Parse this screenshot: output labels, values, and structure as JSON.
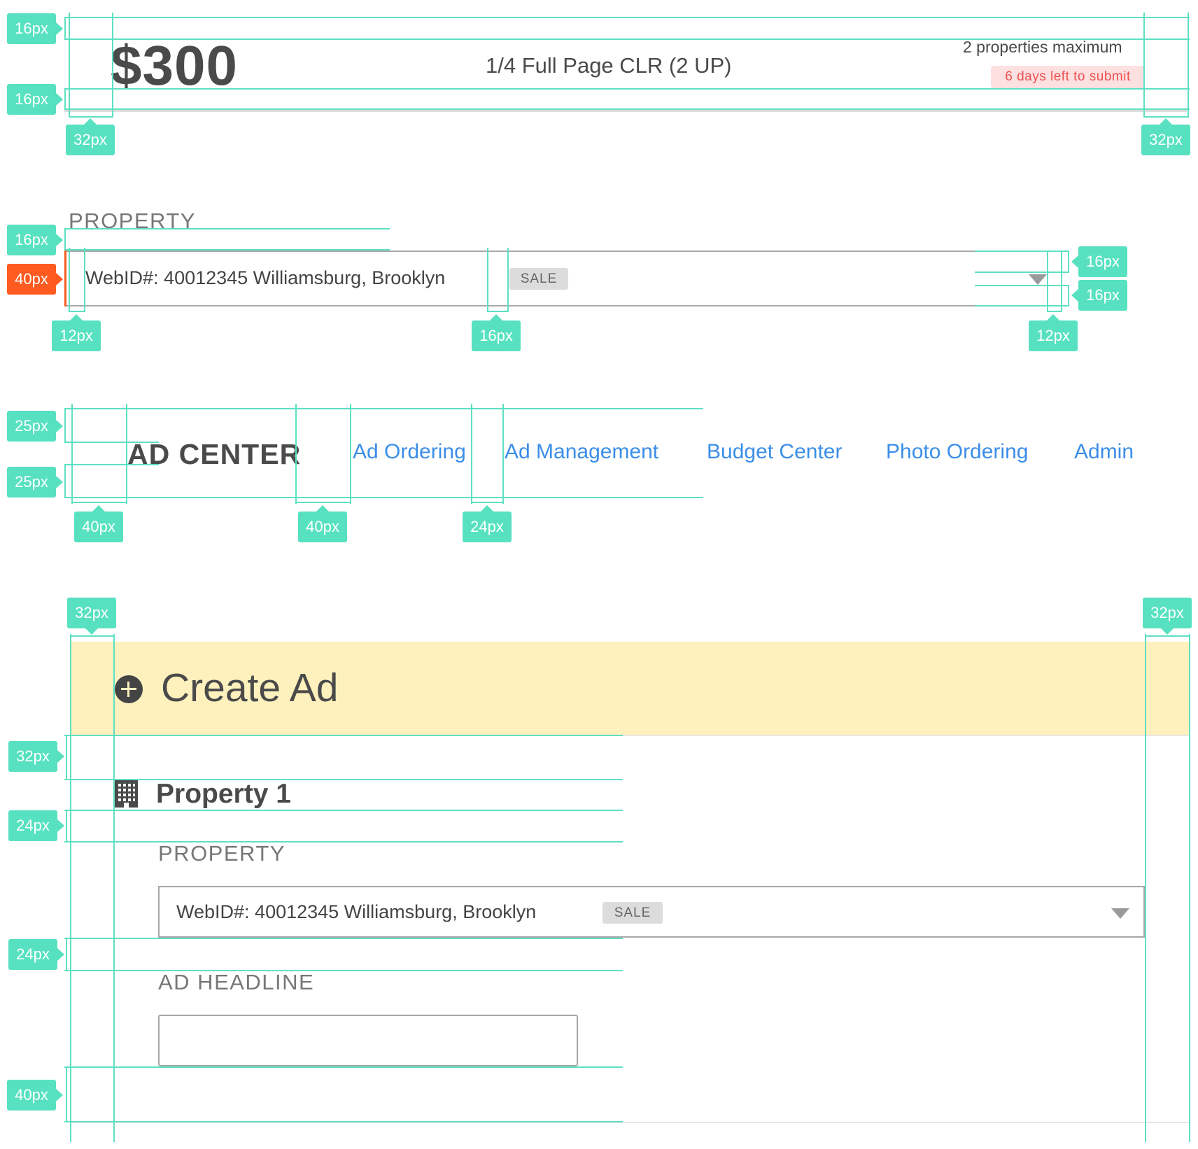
{
  "price_card": {
    "price": "$300",
    "ad_size": "1/4 Full Page CLR (2 UP)",
    "max_properties": "2 properties maximum",
    "deadline": "6 days left to submit"
  },
  "property_select_small": {
    "label": "PROPERTY",
    "value": "WebID#: 40012345 Williamsburg, Brooklyn",
    "badge": "SALE"
  },
  "nav": {
    "brand": "AD CENTER",
    "links": [
      "Ad Ordering",
      "Ad Management",
      "Budget Center",
      "Photo Ordering",
      "Admin"
    ]
  },
  "create_ad": {
    "title": "Create Ad",
    "section_title": "Property 1",
    "property_label": "PROPERTY",
    "property_value": "WebID#: 40012345 Williamsburg, Brooklyn",
    "property_badge": "SALE",
    "headline_label": "AD HEADLINE",
    "headline_value": ""
  },
  "spacing_annotations": {
    "s1": [
      "16px",
      "16px",
      "32px",
      "32px"
    ],
    "s2": [
      "16px",
      "40px",
      "12px",
      "16px",
      "12px",
      "16px",
      "16px"
    ],
    "s3": [
      "25px",
      "25px",
      "40px",
      "40px",
      "24px"
    ],
    "s4": [
      "32px",
      "32px",
      "32px",
      "24px",
      "24px",
      "40px"
    ]
  },
  "colors": {
    "guide": "#57e1c0",
    "highlight": "#ff5a1f",
    "link": "#3b8ee8",
    "banner": "#fef1bd",
    "deadline_bg": "#fde0e0",
    "deadline_text": "#ee5252"
  }
}
